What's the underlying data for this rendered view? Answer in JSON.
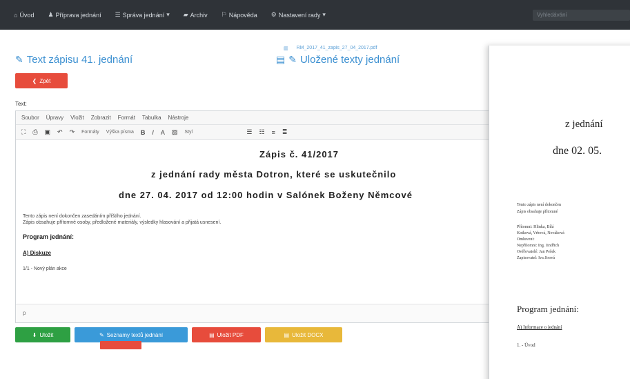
{
  "navbar": {
    "items": [
      {
        "icon": "home-icon",
        "label": "Úvod"
      },
      {
        "icon": "users-icon",
        "label": "Příprava jednání"
      },
      {
        "icon": "list-icon",
        "label": "Správa jednání"
      },
      {
        "icon": "archive-icon",
        "label": "Archiv"
      },
      {
        "icon": "help-icon",
        "label": "Nápověda"
      },
      {
        "icon": "settings-icon",
        "label": "Nastavení rady"
      }
    ],
    "search_placeholder": "Vyhledávání"
  },
  "main": {
    "title": "Text zápisu 41. jednání",
    "saved_title": "Uložené texty jednání",
    "saved_file": "RM_2017_41_zapis_27_04_2017.pdf",
    "back_label": "Zpět",
    "field_label": "Text:",
    "editor": {
      "menu": [
        "Soubor",
        "Úpravy",
        "Vložit",
        "Zobrazit",
        "Formát",
        "Tabulka",
        "Nástroje"
      ],
      "toolbar": {
        "formats_label": "Formáty",
        "font_size_label": "Výška písma",
        "font_label": "Styl"
      },
      "doc": {
        "line1": "Zápis č. 41/2017",
        "line2": "z jednání rady města Dotron, které se uskutečnilo",
        "line3": "dne 27. 04. 2017 od 12:00 hodin v Salónek Boženy Němcové",
        "para1": "Tento zápis není dokončen zasedáním příštího jednání.",
        "para2": "Zápis obsahuje přítomné osoby, předložené materiály, výsledky hlasování a přijatá usnesení.",
        "program": "Program jednání:",
        "section_a": "A) Diskuze",
        "item1": "1/1 - Nový plán akce"
      },
      "status": "p"
    },
    "buttons": {
      "save": "Uložit",
      "saved_text": "Seznamy textů jednání",
      "pdf": "Uložit PDF",
      "word": "Uložit DOCX"
    }
  },
  "preview": {
    "line2": "z jednání",
    "line3": "dne 02. 05.",
    "p1": "Tento zápis není dokončen",
    "p2": "Zápis obsahuje přítomné",
    "p3": "Přítomni: Hlinka, Bílá",
    "p4": "Kotková, Vrbová, Nováková",
    "p5": "Omluveni:",
    "p6": "Nepřítomni: Ing. Jindřich",
    "p7": "Ověřovatelé: Jan Pešek",
    "p8": "Zapisovatel: Iva Jirová",
    "program": "Program jednání:",
    "section_a": "A) Informace o jednání",
    "item1": "1. - Úvod"
  }
}
